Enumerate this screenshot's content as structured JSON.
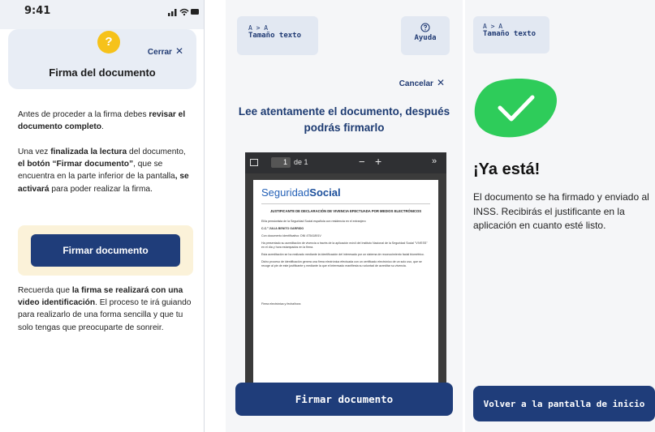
{
  "panel1": {
    "status": {
      "time": "9:41"
    },
    "header": {
      "help_symbol": "?",
      "close_label": "Cerrar",
      "close_symbol": "✕",
      "title": "Firma del documento"
    },
    "para1": {
      "t1": "Antes de proceder a la firma debes ",
      "b1": "revisar el documento completo",
      "t2": "."
    },
    "para2": {
      "t1": "Una vez ",
      "b1": "finalizada la lectura",
      "t2": " del documento, ",
      "b2": "el botón “Firmar documento”",
      "t3": ", que se encuentra en la parte inferior de la pantalla",
      "b3": ", se activará",
      "t4": " para poder realizar la firma."
    },
    "sign_button": "Firmar documento",
    "para3": {
      "t1": "Recuerda que ",
      "b1": "la firma se realizará con una video identificación",
      "t2": ". El proceso te irá guiando para realizarlo de una forma sencilla y que tu solo tengas que preocuparte de sonreir."
    }
  },
  "panel2": {
    "text_size": {
      "icon": "A > A",
      "label": "Tamaño texto"
    },
    "help": {
      "icon": "help-circle-icon",
      "label": "Ayuda"
    },
    "cancel": {
      "label": "Cancelar",
      "symbol": "✕"
    },
    "heading": "Lee atentamente el documento, después podrás firmarlo",
    "viewer": {
      "page_value": "1",
      "page_total": "de 1",
      "zoom_out": "−",
      "zoom_in": "+",
      "more": "»"
    },
    "document": {
      "logo_a": "Seguridad",
      "logo_b": "Social",
      "title": "JUSTIFICANTE DE DECLARACIÓN DE VIVENCIA EFECTUADA POR MEDIOS ELECTRÓNICOS",
      "lines": [
        "El/la pensionista de la Seguridad Social española con residencia en el extranjero",
        "C.C.º JULIA BENITO GARRIDO",
        "Con documento identificativo: DNI 47541891V",
        "Ha presentado su acreditación de vivencia a través de la aplicación móvil del Instituto Nacional de la Seguridad Social \"VIVESS\" en el día y hora estampados en la firma.",
        "Esta acreditación se ha realizado mediante la identificación del interesado por un sistema de reconocimiento facial biométrico.",
        "Dicho proceso de identificación genera una firma electrónica efectuada con un certificado electrónico de un solo uso, que se recoge al pie de este justificante y mediante la que el interesado manifiesta su voluntad de acreditar su vivencia.",
        "Firma electrónica y fecha/hora"
      ]
    },
    "sign_button": "Firmar documento"
  },
  "panel3": {
    "text_size": {
      "icon": "A > A",
      "label": "Tamaño texto"
    },
    "success_icon": "checkmark-icon",
    "title": "¡Ya está!",
    "message": "El documento se ha firmado y enviado al INSS. Recibirás el justificante en la aplicación en cuanto esté listo.",
    "home_button": "Volver a la pantalla de inicio"
  },
  "colors": {
    "primary": "#1f3d7a",
    "help_badge": "#f6c21a",
    "success": "#2ecc5a",
    "chip_bg": "#e2e8f2",
    "cta_box": "#fbf2d9"
  }
}
